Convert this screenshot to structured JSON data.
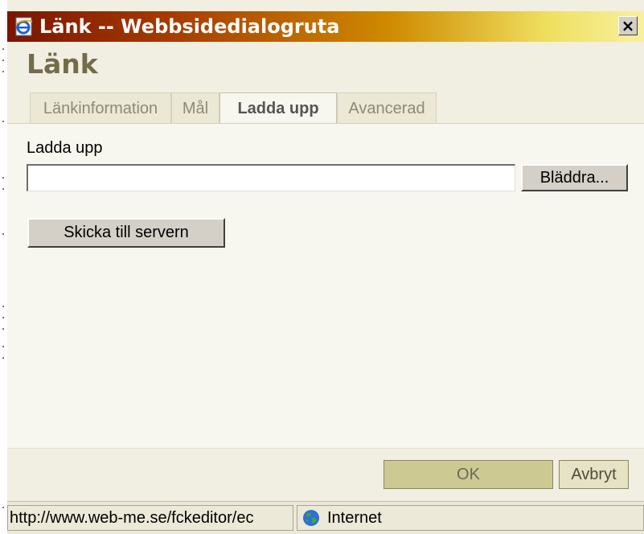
{
  "window": {
    "title": "Länk -- Webbsidedialogruta",
    "close_label": "×"
  },
  "dialog": {
    "heading": "Länk",
    "tabs": [
      {
        "label": "Länkinformation",
        "active": false
      },
      {
        "label": "Mål",
        "active": false
      },
      {
        "label": "Ladda upp",
        "active": true
      },
      {
        "label": "Avancerad",
        "active": false
      }
    ],
    "upload": {
      "label": "Ladda upp",
      "value": "",
      "browse_label": "Bläddra...",
      "send_label": "Skicka till servern"
    },
    "footer": {
      "ok_label": "OK",
      "cancel_label": "Avbryt"
    }
  },
  "statusbar": {
    "url": "http://www.web-me.se/fckeditor/ec",
    "zone": "Internet"
  },
  "icons": {
    "title": "ie-document-icon",
    "zone": "globe-icon"
  }
}
